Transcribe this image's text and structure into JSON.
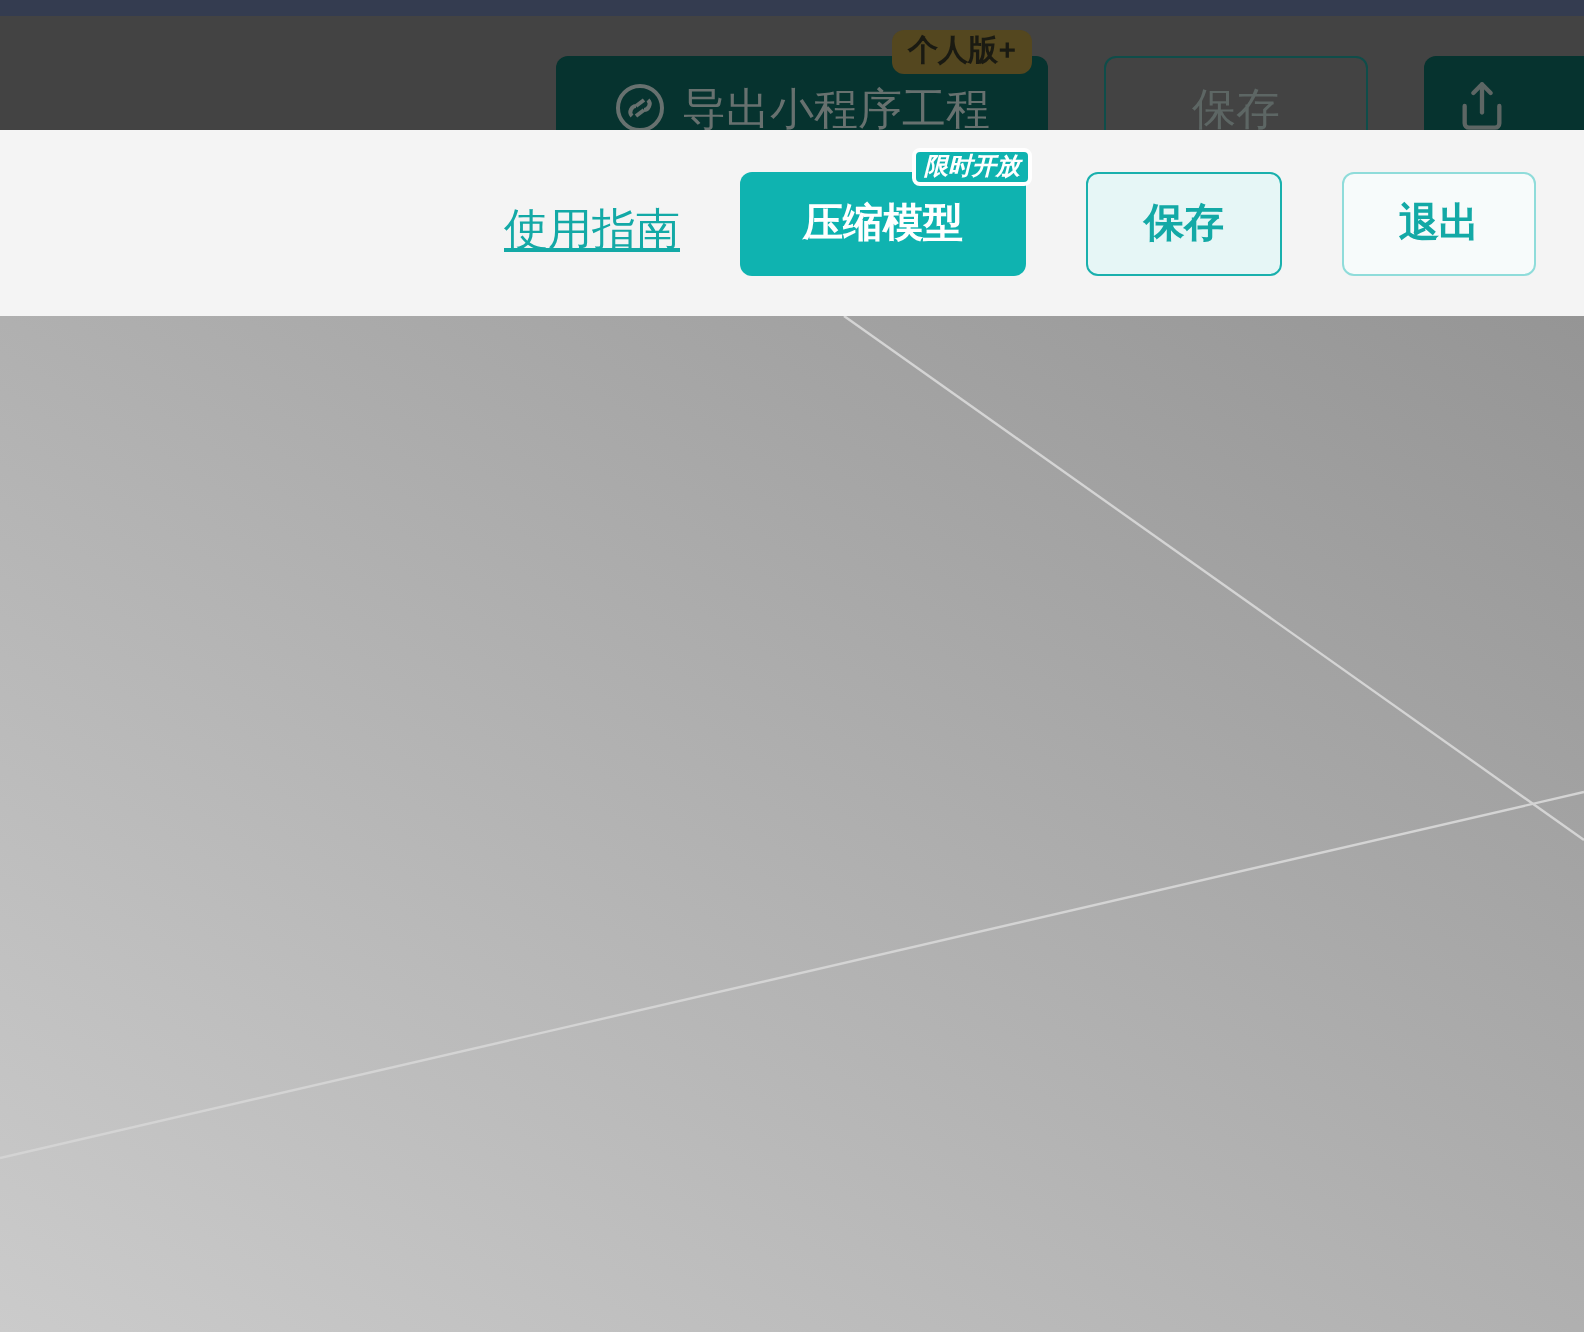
{
  "header": {
    "buttons": [
      {
        "kind": "export",
        "label": "导出小程序工程",
        "badge": "个人版+"
      },
      {
        "kind": "outline",
        "label": "保存"
      },
      {
        "kind": "upload"
      }
    ]
  },
  "toolbar": {
    "guide_link": "使用指南",
    "buttons": [
      {
        "kind": "primary",
        "label": "压缩模型",
        "badge": "限时开放"
      },
      {
        "kind": "secondary",
        "label": "保存"
      },
      {
        "kind": "outline",
        "label": "退出"
      }
    ]
  }
}
